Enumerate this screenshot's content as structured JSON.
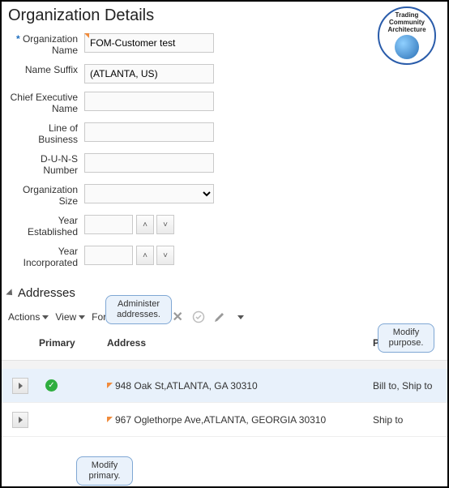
{
  "page": {
    "title": "Organization Details"
  },
  "logo": {
    "line1": "Trading",
    "line2": "Community",
    "line3": "Architecture"
  },
  "form": {
    "org_name": {
      "label": "Organization Name",
      "value": "FOM-Customer test",
      "required": true
    },
    "name_suffix": {
      "label": "Name Suffix",
      "value": "(ATLANTA, US)"
    },
    "ceo_name": {
      "label": "Chief Executive Name",
      "value": ""
    },
    "lob": {
      "label": "Line of Business",
      "value": ""
    },
    "duns": {
      "label": "D-U-N-S Number",
      "value": ""
    },
    "org_size": {
      "label": "Organization Size",
      "value": ""
    },
    "year_est": {
      "label": "Year Established",
      "value": ""
    },
    "year_inc": {
      "label": "Year Incorporated",
      "value": ""
    }
  },
  "addresses": {
    "section_title": "Addresses",
    "toolbar": {
      "actions": "Actions",
      "view": "View",
      "format": "Format"
    },
    "columns": {
      "primary": "Primary",
      "address": "Address",
      "purpose": "Purpose"
    },
    "callouts": {
      "administer": "Administer addresses.",
      "modify_purpose": "Modify purpose.",
      "modify_primary": "Modify primary."
    },
    "rows": [
      {
        "primary": true,
        "address": "948 Oak St,ATLANTA, GA 30310",
        "purpose": "Bill to, Ship to"
      },
      {
        "primary": false,
        "address": "967 Oglethorpe Ave,ATLANTA, GEORGIA 30310",
        "purpose": "Ship to"
      }
    ]
  }
}
